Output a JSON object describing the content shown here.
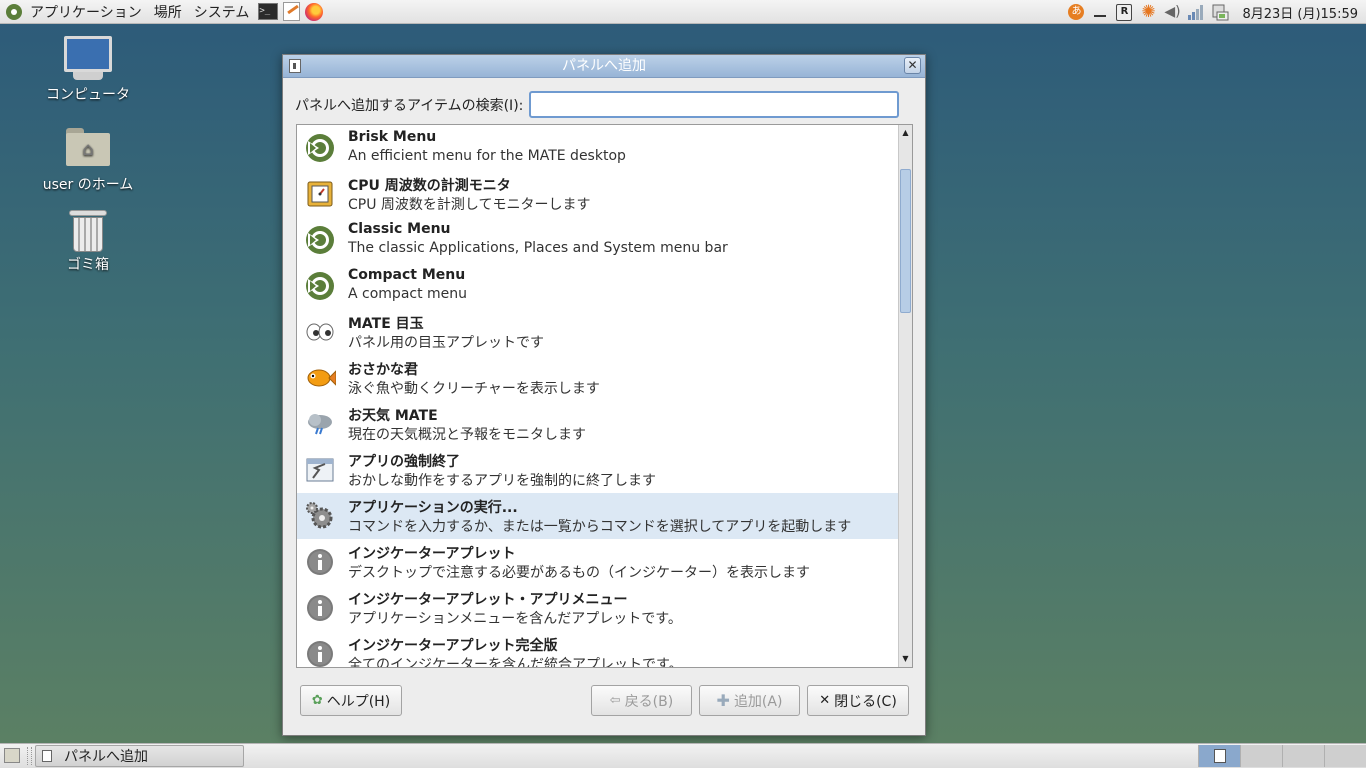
{
  "top_panel": {
    "menus": [
      "アプリケーション",
      "場所",
      "システム"
    ],
    "clock": "8月23日 (月)15:59",
    "ime_label": "あ",
    "r_label": "R"
  },
  "desktop_icons": [
    {
      "label": "コンピュータ"
    },
    {
      "label": "user のホーム"
    },
    {
      "label": "ゴミ箱"
    }
  ],
  "dialog": {
    "title": "パネルへ追加",
    "search_label": "パネルへ追加するアイテムの検索(I):",
    "search_value": "",
    "items": [
      {
        "title": "Brisk Menu",
        "desc": "An efficient menu for the MATE desktop",
        "icon": "mate-logo-icon"
      },
      {
        "title": "CPU 周波数の計測モニタ",
        "desc": "CPU 周波数を計測してモニターします",
        "icon": "cpu-chip-icon"
      },
      {
        "title": "Classic Menu",
        "desc": "The classic Applications, Places and System menu bar",
        "icon": "mate-logo-icon"
      },
      {
        "title": "Compact Menu",
        "desc": "A compact menu",
        "icon": "mate-logo-icon"
      },
      {
        "title": "MATE 目玉",
        "desc": "パネル用の目玉アプレットです",
        "icon": "eyes-icon"
      },
      {
        "title": "おさかな君",
        "desc": "泳ぐ魚や動くクリーチャーを表示します",
        "icon": "fish-icon"
      },
      {
        "title": "お天気 MATE",
        "desc": "現在の天気概況と予報をモニタします",
        "icon": "weather-cloud-icon"
      },
      {
        "title": "アプリの強制終了",
        "desc": "おかしな動作をするアプリを強制的に終了します",
        "icon": "force-quit-icon"
      },
      {
        "title": "アプリケーションの実行...",
        "desc": "コマンドを入力するか、または一覧からコマンドを選択してアプリを起動します",
        "icon": "run-gears-icon"
      },
      {
        "title": "インジケーターアプレット",
        "desc": "デスクトップで注意する必要があるもの（インジケーター）を表示します",
        "icon": "info-icon"
      },
      {
        "title": "インジケーターアプレット・アプリメニュー",
        "desc": "アプリケーションメニューを含んだアプレットです。",
        "icon": "info-icon"
      },
      {
        "title": "インジケーターアプレット完全版",
        "desc": "全てのインジケーターを含んだ統合アプレットです。",
        "icon": "info-icon"
      }
    ],
    "selected_index": 8,
    "buttons": {
      "help": "ヘルプ(H)",
      "back": "戻る(B)",
      "add": "追加(A)",
      "close": "閉じる(C)"
    }
  },
  "bottom_panel": {
    "task_label": "パネルへ追加"
  },
  "colors": {
    "selection": "#dce8f4",
    "titlebar": "#a8c1de",
    "mate_green": "#5b7e3a"
  }
}
